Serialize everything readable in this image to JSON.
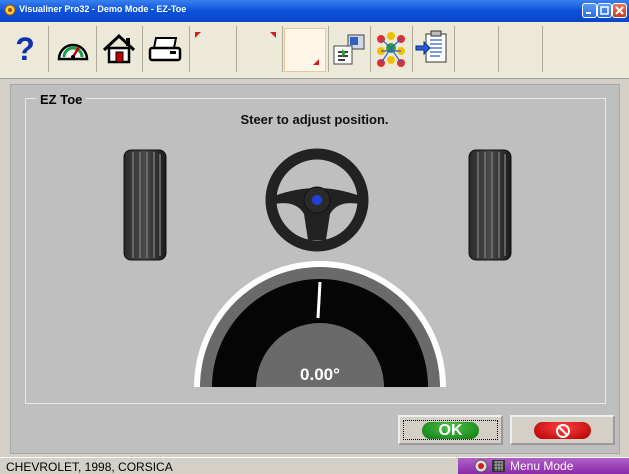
{
  "window": {
    "title": "Visualiner Pro32 - Demo Mode - EZ-Toe"
  },
  "toolbar": {
    "icons": [
      "help-icon",
      "gauge-icon",
      "home-icon",
      "printer-icon",
      "vehicle-specs-icon",
      "puzzle-icon",
      "export-report-icon"
    ]
  },
  "panel": {
    "group_label": "EZ Toe",
    "instruction": "Steer  to adjust position.",
    "gauge_value": "0.00°",
    "gauge_reading": 0.0
  },
  "buttons": {
    "ok_label": "OK",
    "cancel_icon": "no-icon"
  },
  "status": {
    "vehicle": "CHEVROLET, 1998, CORSICA",
    "mode": "Menu Mode"
  },
  "colors": {
    "titlebar": "#0b52d9",
    "ok": "#1a9a1a",
    "cancel": "#e01010",
    "mode_bar": "#9a3ab8",
    "steering_dot": "#2040e0"
  }
}
